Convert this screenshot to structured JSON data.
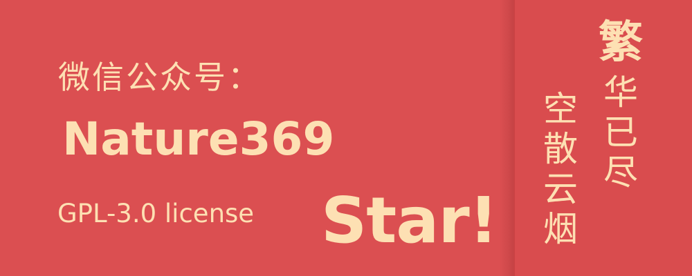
{
  "banner": {
    "wechat_label": "微信公众号：",
    "account_name": "Nature369",
    "license": "GPL-3.0 license",
    "star": "Star!"
  },
  "poem": {
    "right_column": [
      "繁",
      "华",
      "已",
      "尽"
    ],
    "left_column": [
      "空",
      "散",
      "云",
      "烟"
    ]
  },
  "colors": {
    "background": "#db4f51",
    "text": "#fde0b3"
  }
}
